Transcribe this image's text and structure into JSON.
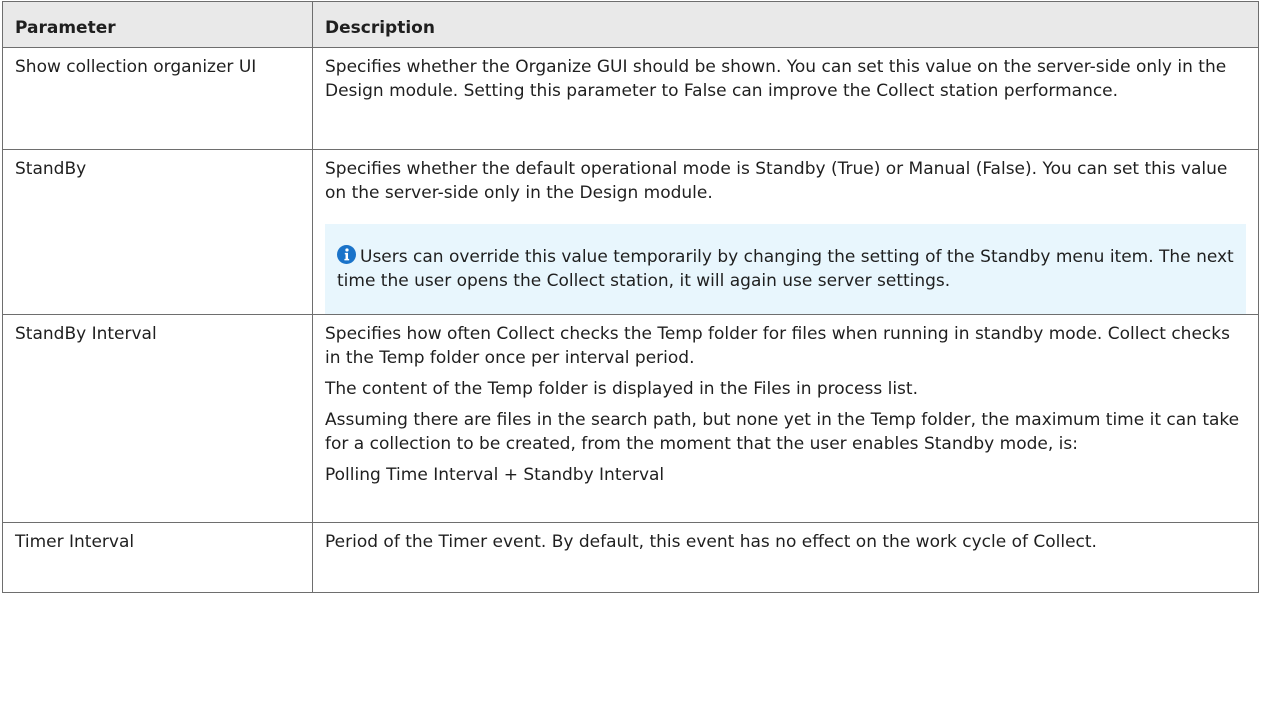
{
  "table": {
    "headers": {
      "parameter": "Parameter",
      "description": "Description"
    },
    "rows": [
      {
        "parameter": "Show collection organizer UI",
        "paragraphs": [
          "Specifies whether the Organize GUI should be shown. You can set this value on the server-side only in the Design module. Setting this parameter to False can improve the Collect station performance."
        ]
      },
      {
        "parameter": "StandBy",
        "paragraphs": [
          "Specifies whether the default operational mode is Standby (True) or Manual (False). You can set this value on the server-side only in the Design module."
        ],
        "note": {
          "icon": "info-icon",
          "text": "Users can override this value temporarily by changing the setting of the Standby menu item. The next time the user opens the Collect station, it will again use server settings."
        }
      },
      {
        "parameter": "StandBy Interval",
        "paragraphs": [
          "Specifies how often Collect checks the Temp folder for files when running in standby mode. Collect checks in the Temp folder once per interval period.",
          "The content of the Temp folder is displayed in the Files in process list.",
          "Assuming there are files in the search path, but none yet in the Temp folder, the maximum time it can take for a collection to be created, from the moment that the user enables Standby mode, is:",
          "Polling Time Interval + Standby Interval"
        ]
      },
      {
        "parameter": "Timer Interval",
        "paragraphs": [
          "Period of the Timer event. By default, this event has no effect on the work cycle of Collect."
        ]
      }
    ]
  },
  "colors": {
    "header_bg": "#e9e9e9",
    "border": "#6e6e6e",
    "note_bg": "#e8f6fd",
    "info_icon": "#1a73c9"
  }
}
